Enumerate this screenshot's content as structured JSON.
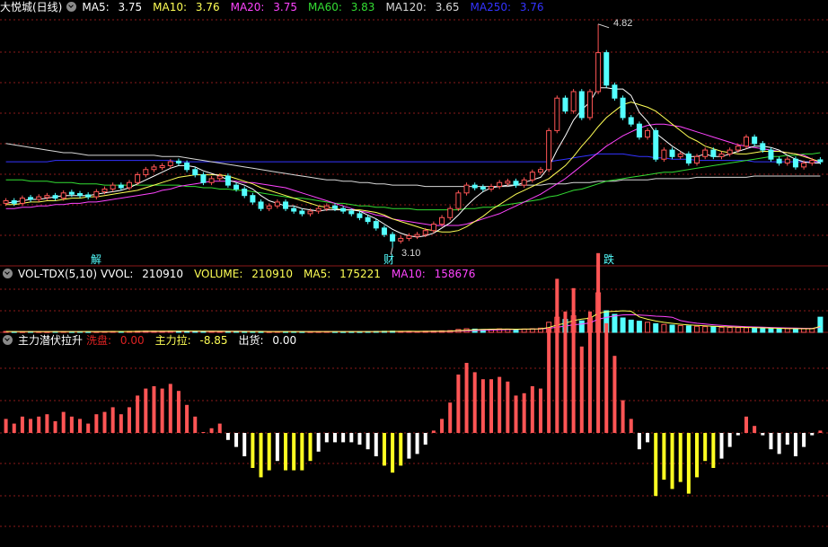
{
  "main_legend": {
    "title": "大悦城(日线)",
    "ma5": {
      "label": "MA5:",
      "value": "3.75",
      "color": "#ffffff"
    },
    "ma10": {
      "label": "MA10:",
      "value": "3.76",
      "color": "#ffff55"
    },
    "ma20": {
      "label": "MA20:",
      "value": "3.75",
      "color": "#ff44ff"
    },
    "ma60": {
      "label": "MA60:",
      "value": "3.83",
      "color": "#33dd33"
    },
    "ma120": {
      "label": "MA120:",
      "value": "3.65",
      "color": "#d8d8d8"
    },
    "ma250": {
      "label": "MA250:",
      "value": "3.76",
      "color": "#3333ff"
    }
  },
  "vol_legend": {
    "name": "VOL-TDX(5,10)",
    "vvol": {
      "label": "VVOL:",
      "value": "210910"
    },
    "volume": {
      "label": "VOLUME:",
      "value": "210910",
      "color": "#ffff55"
    },
    "ma5": {
      "label": "MA5:",
      "value": "175221",
      "color": "#ffff55"
    },
    "ma10": {
      "label": "MA10:",
      "value": "158676",
      "color": "#ff44ff"
    }
  },
  "ind_legend": {
    "name": "主力潜伏拉升",
    "wash": {
      "label": "洗盘:",
      "value": "0.00",
      "color": "#dd2222"
    },
    "pull": {
      "label": "主力拉:",
      "value": "-8.85",
      "color": "#ffff55"
    },
    "ship": {
      "label": "出货:",
      "value": "0.00",
      "color": "#ffffff"
    }
  },
  "annotations": {
    "high": "4.82",
    "low": "3.10",
    "marker_1": "解",
    "marker_2": "财",
    "marker_3": "跌"
  },
  "colors": {
    "up": "#ff5555",
    "down": "#54ffff",
    "grid": "#8b1a1a"
  },
  "chart_data": [
    {
      "type": "candlestick",
      "title": "大悦城(日线)",
      "ylim": [
        3.0,
        4.95
      ],
      "bars": 100,
      "high_value": 4.82,
      "high_index": 72,
      "low_value": 3.1,
      "low_index": 47,
      "close": [
        3.46,
        3.44,
        3.48,
        3.47,
        3.49,
        3.5,
        3.48,
        3.52,
        3.51,
        3.5,
        3.49,
        3.53,
        3.55,
        3.58,
        3.56,
        3.6,
        3.66,
        3.7,
        3.72,
        3.73,
        3.76,
        3.75,
        3.7,
        3.66,
        3.6,
        3.63,
        3.65,
        3.58,
        3.55,
        3.5,
        3.45,
        3.4,
        3.42,
        3.45,
        3.4,
        3.38,
        3.36,
        3.38,
        3.4,
        3.42,
        3.4,
        3.38,
        3.36,
        3.33,
        3.3,
        3.25,
        3.2,
        3.15,
        3.17,
        3.19,
        3.2,
        3.23,
        3.28,
        3.33,
        3.4,
        3.52,
        3.58,
        3.56,
        3.55,
        3.57,
        3.6,
        3.61,
        3.58,
        3.62,
        3.68,
        3.7,
        4.0,
        4.25,
        4.15,
        4.3,
        4.1,
        4.3,
        4.6,
        4.35,
        4.25,
        4.1,
        4.05,
        3.95,
        4.0,
        3.78,
        3.85,
        3.8,
        3.82,
        3.75,
        3.8,
        3.85,
        3.8,
        3.82,
        3.85,
        3.88,
        3.95,
        3.9,
        3.85,
        3.78,
        3.75,
        3.78,
        3.72,
        3.75,
        3.77,
        3.76
      ],
      "ma5": [
        3.44,
        3.45,
        3.46,
        3.47,
        3.47,
        3.48,
        3.49,
        3.5,
        3.5,
        3.5,
        3.5,
        3.51,
        3.52,
        3.53,
        3.54,
        3.56,
        3.59,
        3.62,
        3.65,
        3.68,
        3.71,
        3.73,
        3.73,
        3.72,
        3.69,
        3.67,
        3.65,
        3.62,
        3.6,
        3.58,
        3.55,
        3.5,
        3.46,
        3.44,
        3.42,
        3.42,
        3.4,
        3.39,
        3.38,
        3.39,
        3.39,
        3.39,
        3.39,
        3.38,
        3.35,
        3.32,
        3.28,
        3.24,
        3.21,
        3.19,
        3.18,
        3.19,
        3.21,
        3.25,
        3.29,
        3.35,
        3.42,
        3.48,
        3.53,
        3.56,
        3.57,
        3.58,
        3.58,
        3.6,
        3.62,
        3.64,
        3.72,
        3.85,
        3.96,
        4.08,
        4.16,
        4.22,
        4.33,
        4.33,
        4.32,
        4.32,
        4.27,
        4.14,
        4.07,
        3.98,
        3.93,
        3.88,
        3.84,
        3.8,
        3.8,
        3.82,
        3.8,
        3.8,
        3.82,
        3.84,
        3.86,
        3.88,
        3.88,
        3.87,
        3.85,
        3.81,
        3.78,
        3.76,
        3.75,
        3.75
      ],
      "ma10": [
        3.43,
        3.43,
        3.44,
        3.45,
        3.45,
        3.46,
        3.46,
        3.47,
        3.48,
        3.48,
        3.49,
        3.49,
        3.5,
        3.51,
        3.52,
        3.53,
        3.54,
        3.56,
        3.58,
        3.6,
        3.62,
        3.64,
        3.65,
        3.66,
        3.66,
        3.66,
        3.66,
        3.65,
        3.63,
        3.61,
        3.59,
        3.56,
        3.54,
        3.52,
        3.5,
        3.48,
        3.46,
        3.44,
        3.42,
        3.41,
        3.4,
        3.39,
        3.39,
        3.39,
        3.38,
        3.37,
        3.35,
        3.32,
        3.3,
        3.28,
        3.26,
        3.24,
        3.23,
        3.22,
        3.22,
        3.23,
        3.26,
        3.3,
        3.34,
        3.39,
        3.43,
        3.47,
        3.51,
        3.54,
        3.57,
        3.6,
        3.63,
        3.68,
        3.73,
        3.8,
        3.88,
        3.95,
        4.03,
        4.1,
        4.15,
        4.2,
        4.22,
        4.2,
        4.18,
        4.15,
        4.1,
        4.05,
        4.0,
        3.95,
        3.92,
        3.88,
        3.86,
        3.84,
        3.83,
        3.82,
        3.82,
        3.83,
        3.84,
        3.84,
        3.84,
        3.83,
        3.82,
        3.8,
        3.78,
        3.76
      ],
      "ma20": [
        3.4,
        3.4,
        3.41,
        3.41,
        3.42,
        3.42,
        3.43,
        3.43,
        3.44,
        3.44,
        3.45,
        3.45,
        3.46,
        3.47,
        3.48,
        3.49,
        3.5,
        3.51,
        3.52,
        3.54,
        3.55,
        3.57,
        3.58,
        3.59,
        3.6,
        3.61,
        3.61,
        3.61,
        3.61,
        3.6,
        3.6,
        3.59,
        3.58,
        3.57,
        3.56,
        3.54,
        3.52,
        3.5,
        3.48,
        3.46,
        3.44,
        3.42,
        3.4,
        3.38,
        3.37,
        3.35,
        3.34,
        3.32,
        3.31,
        3.3,
        3.29,
        3.28,
        3.27,
        3.27,
        3.27,
        3.27,
        3.28,
        3.3,
        3.32,
        3.34,
        3.36,
        3.39,
        3.42,
        3.45,
        3.48,
        3.51,
        3.55,
        3.59,
        3.63,
        3.68,
        3.73,
        3.78,
        3.83,
        3.88,
        3.92,
        3.96,
        3.99,
        4.02,
        4.04,
        4.05,
        4.05,
        4.04,
        4.03,
        4.01,
        3.99,
        3.97,
        3.95,
        3.93,
        3.91,
        3.89,
        3.88,
        3.87,
        3.86,
        3.85,
        3.84,
        3.83,
        3.82,
        3.81,
        3.78,
        3.75
      ],
      "ma60": [
        3.62,
        3.62,
        3.62,
        3.61,
        3.61,
        3.61,
        3.6,
        3.6,
        3.6,
        3.59,
        3.59,
        3.59,
        3.58,
        3.58,
        3.58,
        3.58,
        3.58,
        3.58,
        3.58,
        3.58,
        3.58,
        3.58,
        3.57,
        3.57,
        3.56,
        3.56,
        3.55,
        3.55,
        3.54,
        3.54,
        3.53,
        3.52,
        3.51,
        3.5,
        3.49,
        3.48,
        3.48,
        3.47,
        3.46,
        3.45,
        3.44,
        3.44,
        3.43,
        3.42,
        3.42,
        3.41,
        3.41,
        3.4,
        3.4,
        3.4,
        3.39,
        3.39,
        3.39,
        3.39,
        3.39,
        3.39,
        3.4,
        3.4,
        3.41,
        3.41,
        3.42,
        3.43,
        3.44,
        3.45,
        3.46,
        3.47,
        3.49,
        3.5,
        3.52,
        3.54,
        3.55,
        3.57,
        3.59,
        3.61,
        3.62,
        3.63,
        3.64,
        3.65,
        3.66,
        3.67,
        3.68,
        3.68,
        3.69,
        3.7,
        3.71,
        3.72,
        3.73,
        3.74,
        3.75,
        3.76,
        3.77,
        3.78,
        3.79,
        3.8,
        3.8,
        3.81,
        3.81,
        3.82,
        3.82,
        3.83
      ],
      "ma120": [
        3.9,
        3.89,
        3.88,
        3.87,
        3.86,
        3.85,
        3.84,
        3.83,
        3.83,
        3.82,
        3.81,
        3.81,
        3.81,
        3.81,
        3.81,
        3.81,
        3.81,
        3.81,
        3.81,
        3.8,
        3.8,
        3.8,
        3.79,
        3.78,
        3.77,
        3.76,
        3.75,
        3.74,
        3.73,
        3.72,
        3.71,
        3.7,
        3.69,
        3.68,
        3.67,
        3.66,
        3.65,
        3.64,
        3.63,
        3.62,
        3.62,
        3.61,
        3.61,
        3.6,
        3.6,
        3.59,
        3.59,
        3.58,
        3.58,
        3.58,
        3.58,
        3.57,
        3.57,
        3.57,
        3.57,
        3.57,
        3.57,
        3.57,
        3.57,
        3.57,
        3.57,
        3.57,
        3.58,
        3.58,
        3.58,
        3.58,
        3.59,
        3.59,
        3.59,
        3.6,
        3.6,
        3.6,
        3.61,
        3.61,
        3.61,
        3.62,
        3.62,
        3.62,
        3.62,
        3.63,
        3.63,
        3.63,
        3.63,
        3.63,
        3.64,
        3.64,
        3.64,
        3.64,
        3.64,
        3.64,
        3.64,
        3.65,
        3.65,
        3.65,
        3.65,
        3.65,
        3.65,
        3.65,
        3.65,
        3.65
      ],
      "ma250": [
        3.76,
        3.76,
        3.76,
        3.76,
        3.76,
        3.76,
        3.77,
        3.77,
        3.77,
        3.77,
        3.77,
        3.77,
        3.77,
        3.77,
        3.77,
        3.77,
        3.77,
        3.77,
        3.77,
        3.77,
        3.77,
        3.76,
        3.76,
        3.76,
        3.76,
        3.76,
        3.76,
        3.76,
        3.76,
        3.76,
        3.76,
        3.76,
        3.76,
        3.76,
        3.76,
        3.76,
        3.76,
        3.76,
        3.76,
        3.76,
        3.76,
        3.76,
        3.76,
        3.76,
        3.76,
        3.76,
        3.76,
        3.76,
        3.76,
        3.76,
        3.76,
        3.76,
        3.76,
        3.76,
        3.76,
        3.76,
        3.76,
        3.76,
        3.76,
        3.76,
        3.76,
        3.76,
        3.76,
        3.76,
        3.76,
        3.76,
        3.76,
        3.77,
        3.78,
        3.79,
        3.8,
        3.81,
        3.82,
        3.82,
        3.82,
        3.82,
        3.81,
        3.8,
        3.8,
        3.79,
        3.79,
        3.78,
        3.78,
        3.78,
        3.77,
        3.77,
        3.77,
        3.77,
        3.77,
        3.77,
        3.77,
        3.76,
        3.76,
        3.76,
        3.76,
        3.76,
        3.76,
        3.76,
        3.76,
        3.76
      ]
    },
    {
      "type": "bar",
      "title": "VOL-TDX(5,10)",
      "ylim": [
        0,
        700000
      ],
      "volume": [
        12000,
        11000,
        10500,
        12500,
        11000,
        10000,
        13000,
        12000,
        11500,
        12500,
        11000,
        10800,
        12000,
        13500,
        12500,
        14000,
        16000,
        18000,
        17000,
        16500,
        19000,
        18000,
        17000,
        15500,
        14000,
        15000,
        13000,
        12500,
        13000,
        11500,
        12000,
        11000,
        10500,
        12000,
        11500,
        12000,
        11000,
        10800,
        11500,
        12000,
        11000,
        10500,
        11000,
        10800,
        12000,
        13500,
        15000,
        16500,
        14000,
        13000,
        12500,
        15000,
        18000,
        21000,
        24000,
        40000,
        50000,
        45000,
        40000,
        44000,
        48000,
        45000,
        42000,
        46000,
        50000,
        58000,
        140000,
        210000,
        180000,
        230000,
        160000,
        200000,
        550000,
        300000,
        250000,
        200000,
        170000,
        155000,
        140000,
        120000,
        110000,
        100000,
        95000,
        90000,
        85000,
        80000,
        75000,
        70000,
        68000,
        66000,
        64000,
        60000,
        55000,
        52000,
        50000,
        52000,
        48000,
        50000,
        52000,
        210910
      ],
      "up": [
        1,
        0,
        1,
        0,
        1,
        1,
        0,
        1,
        0,
        0,
        0,
        1,
        1,
        1,
        0,
        1,
        1,
        1,
        1,
        1,
        1,
        0,
        0,
        0,
        0,
        1,
        1,
        0,
        0,
        0,
        0,
        0,
        1,
        1,
        0,
        0,
        0,
        1,
        1,
        1,
        0,
        0,
        0,
        0,
        0,
        0,
        0,
        0,
        1,
        1,
        1,
        1,
        1,
        1,
        1,
        1,
        1,
        0,
        0,
        1,
        1,
        1,
        0,
        1,
        1,
        1,
        1,
        1,
        0,
        1,
        0,
        1,
        1,
        0,
        0,
        0,
        0,
        0,
        1,
        0,
        1,
        0,
        1,
        0,
        1,
        1,
        0,
        1,
        1,
        1,
        1,
        0,
        0,
        0,
        0,
        1,
        0,
        1,
        1,
        0
      ]
    },
    {
      "type": "bar",
      "title": "主力潜伏拉升",
      "series": [
        {
          "name": "洗盘",
          "color": "#ff5555",
          "indices": [
            0,
            1,
            2,
            3,
            4,
            5,
            6,
            7,
            8,
            9,
            10,
            11,
            12,
            13,
            14,
            15,
            16,
            17,
            18,
            19,
            20,
            21,
            22,
            23,
            24,
            25,
            26,
            27,
            28,
            29,
            30,
            31,
            32,
            33,
            34,
            35,
            36,
            37,
            38,
            39,
            40,
            41,
            42,
            43,
            44,
            45,
            46,
            47,
            48,
            49,
            50,
            92,
            93,
            94,
            95,
            96,
            97,
            98,
            99
          ]
        },
        {
          "name": "主力拉",
          "color": "#ffff22"
        },
        {
          "name": "出货",
          "color": "#ffffff"
        }
      ]
    }
  ]
}
